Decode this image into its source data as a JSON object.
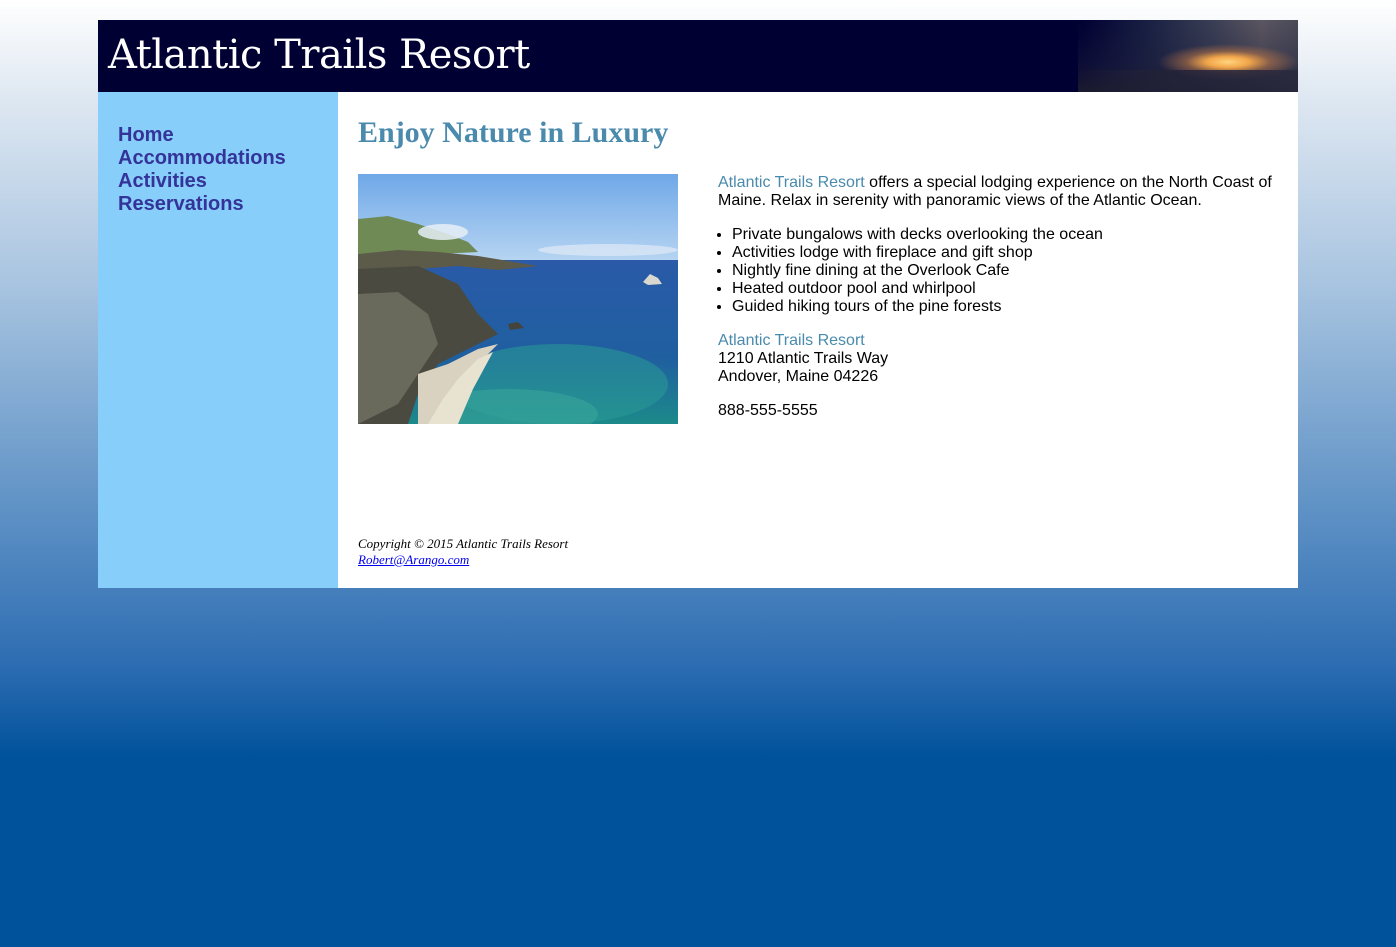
{
  "site": {
    "title": "Atlantic Trails Resort"
  },
  "nav": {
    "items": [
      {
        "label": "Home"
      },
      {
        "label": "Accommodations"
      },
      {
        "label": "Activities"
      },
      {
        "label": "Reservations"
      }
    ]
  },
  "main": {
    "heading": "Enjoy Nature in Luxury",
    "intro_brand": "Atlantic Trails Resort",
    "intro_text": " offers a special lodging experience on the North Coast of Maine. Relax in serenity with panoramic views of the Atlantic Ocean.",
    "features": [
      "Private bungalows with decks overlooking the ocean",
      "Activities lodge with fireplace and gift shop",
      "Nightly fine dining at the Overlook Cafe",
      "Heated outdoor pool and whirlpool",
      "Guided hiking tours of the pine forests"
    ],
    "address": {
      "name": "Atlantic Trails Resort",
      "street": "1210 Atlantic Trails Way",
      "city": "Andover, Maine 04226"
    },
    "phone": "888-555-5555"
  },
  "footer": {
    "copyright": "Copyright © 2015 Atlantic Trails Resort",
    "email": "Robert@Arango.com"
  },
  "colors": {
    "header_bg": "#000033",
    "nav_bg": "#87cefa",
    "nav_link": "#333399",
    "heading": "#4a8aac"
  }
}
